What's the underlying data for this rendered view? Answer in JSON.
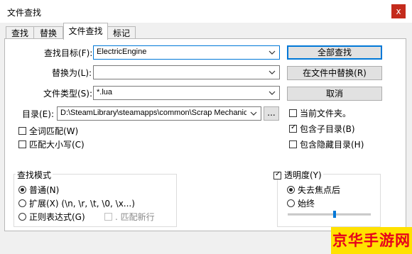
{
  "window": {
    "title": "文件查找",
    "close": "x"
  },
  "tabs": [
    "查找",
    "替换",
    "文件查找",
    "标记"
  ],
  "form": {
    "find_label": "查找目标(F):",
    "find_value": "ElectricEngine",
    "replace_label": "替换为(L):",
    "replace_value": "",
    "filetype_label": "文件类型(S):",
    "filetype_value": "*.lua",
    "dir_label": "目录(E):",
    "dir_value": "D:\\SteamLibrary\\steamapps\\common\\Scrap Mechanic\\",
    "browse": "..."
  },
  "buttons": {
    "find_all": "全部查找",
    "replace_in_files": "在文件中替换(R)",
    "cancel": "取消"
  },
  "options": {
    "whole_word": "全词匹配(W)",
    "match_case": "匹配大小写(C)",
    "current_folder": "当前文件夹。",
    "subfolders": "包含子目录(B)",
    "hidden": "包含隐藏目录(H)"
  },
  "search_mode": {
    "title": "查找模式",
    "normal": "普通(N)",
    "extended": "扩展(X) (\\n, \\r, \\t, \\0, \\x...)",
    "regex": "正则表达式(G)",
    "dot_newline": ". 匹配新行"
  },
  "transparency": {
    "title": "透明度(Y)",
    "on_lose_focus": "失去焦点后",
    "always": "始终",
    "level": 0.56
  },
  "watermark": "京华手游网"
}
